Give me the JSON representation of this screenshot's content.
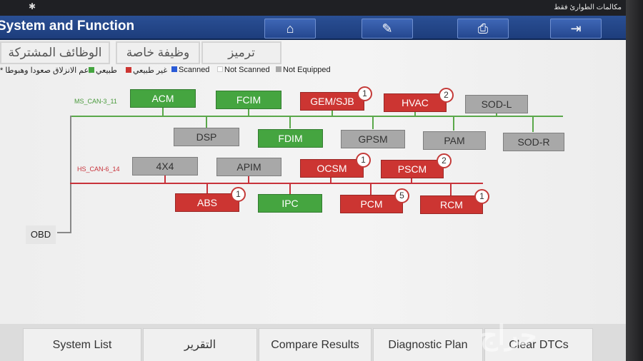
{
  "status_bar": {
    "carrier": "مكالمات الطوارئ فقط"
  },
  "header": {
    "title": "System and Function",
    "buttons": {
      "home": "⌂",
      "edit": "✎",
      "print": "⎙",
      "exit": "⇥"
    }
  },
  "tabs": [
    "الوظائف المشتركة",
    "وظيفة خاصة",
    "ترميز"
  ],
  "legend": {
    "support_note": "* دعم الانزلاق صعودا وهبوطا",
    "normal": "طبيعي",
    "abnormal": "غير طبيعي",
    "scanned": "Scanned",
    "not_scanned": "Not Scanned",
    "not_equipped": "Not Equipped"
  },
  "colors": {
    "normal": "#45a540",
    "abnormal": "#cc3532",
    "scanned": "#2a5bd7",
    "not_scanned": "#ffffff",
    "not_equipped": "#a8a8a8",
    "ms_bus": "#5aa84a",
    "hs_bus": "#c8323a"
  },
  "buses": {
    "ms": "MS_CAN-3_11",
    "hs": "HS_CAN-6_14"
  },
  "modules": {
    "acm": {
      "label": "ACM",
      "status": "normal"
    },
    "fcim": {
      "label": "FCIM",
      "status": "normal"
    },
    "gem": {
      "label": "GEM/SJB",
      "status": "abnormal",
      "dtc": "1"
    },
    "hvac": {
      "label": "HVAC",
      "status": "abnormal",
      "dtc": "2"
    },
    "sodl": {
      "label": "SOD-L",
      "status": "not_equipped"
    },
    "dsp": {
      "label": "DSP",
      "status": "not_equipped"
    },
    "fdim": {
      "label": "FDIM",
      "status": "normal"
    },
    "gpsm": {
      "label": "GPSM",
      "status": "not_equipped"
    },
    "pam": {
      "label": "PAM",
      "status": "not_equipped"
    },
    "sodr": {
      "label": "SOD-R",
      "status": "not_equipped"
    },
    "x4": {
      "label": "4X4",
      "status": "not_equipped"
    },
    "apim": {
      "label": "APIM",
      "status": "not_equipped"
    },
    "ocsm": {
      "label": "OCSM",
      "status": "abnormal",
      "dtc": "1"
    },
    "pscm": {
      "label": "PSCM",
      "status": "abnormal",
      "dtc": "2"
    },
    "abs": {
      "label": "ABS",
      "status": "abnormal",
      "dtc": "1"
    },
    "ipc": {
      "label": "IPC",
      "status": "normal"
    },
    "pcm": {
      "label": "PCM",
      "status": "abnormal",
      "dtc": "5"
    },
    "rcm": {
      "label": "RCM",
      "status": "abnormal",
      "dtc": "1"
    }
  },
  "obd": "OBD",
  "bottom_buttons": [
    "System List",
    "التقرير",
    "Compare Results",
    "Diagnostic Plan",
    "Clear DTCs"
  ],
  "watermark": "حراج"
}
